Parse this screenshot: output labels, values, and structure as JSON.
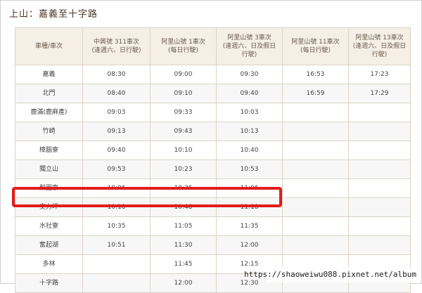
{
  "page": {
    "title": "上山：嘉義至十字路"
  },
  "table": {
    "headers": [
      "車種/車次",
      "中興號 311車次\n(逢週六、日行駛)",
      "阿里山號 1車次\n(每日行駛)",
      "阿里山號 3車次\n(逢週六、日及假日\n行駛)",
      "阿里山號 11車次\n(每日行駛)",
      "阿里山號 13車次\n(逢週六、日及假日\n行駛)"
    ],
    "rows": [
      [
        "嘉義",
        "08:30",
        "09:00",
        "09:30",
        "16:53",
        "17:23"
      ],
      [
        "北門",
        "08:40",
        "09:10",
        "09:40",
        "16:59",
        "17:29"
      ],
      [
        "鹿滿(鹿麻產)",
        "09:03",
        "09:33",
        "10:03",
        "",
        ""
      ],
      [
        "竹崎",
        "09:13",
        "09:43",
        "10:13",
        "",
        ""
      ],
      [
        "樟腦寮",
        "09:40",
        "10:10",
        "10:40",
        "",
        ""
      ],
      [
        "獨立山",
        "09:53",
        "10:23",
        "10:53",
        "",
        ""
      ],
      [
        "梨園寮",
        "10:06",
        "10:36",
        "11:06",
        "",
        ""
      ],
      [
        "交力坪",
        "10:18",
        "10:48",
        "11:18",
        "",
        ""
      ],
      [
        "水社寮",
        "10:35",
        "11:05",
        "11:35",
        "",
        ""
      ],
      [
        "奮起湖",
        "10:51",
        "11:30",
        "12:00",
        "",
        ""
      ],
      [
        "多林",
        "",
        "11:45",
        "12:15",
        "",
        ""
      ],
      [
        "十字路",
        "",
        "12:00",
        "12:30",
        "",
        ""
      ]
    ]
  },
  "highlight": {
    "color": "#e11d1d",
    "row_label": "交力坪"
  },
  "watermark": {
    "text": "https://shaoweiwu088.pixnet.net/album"
  },
  "colors": {
    "header_bg": "#f5efe6",
    "border": "#dcd3c8",
    "title": "#4a3526"
  }
}
